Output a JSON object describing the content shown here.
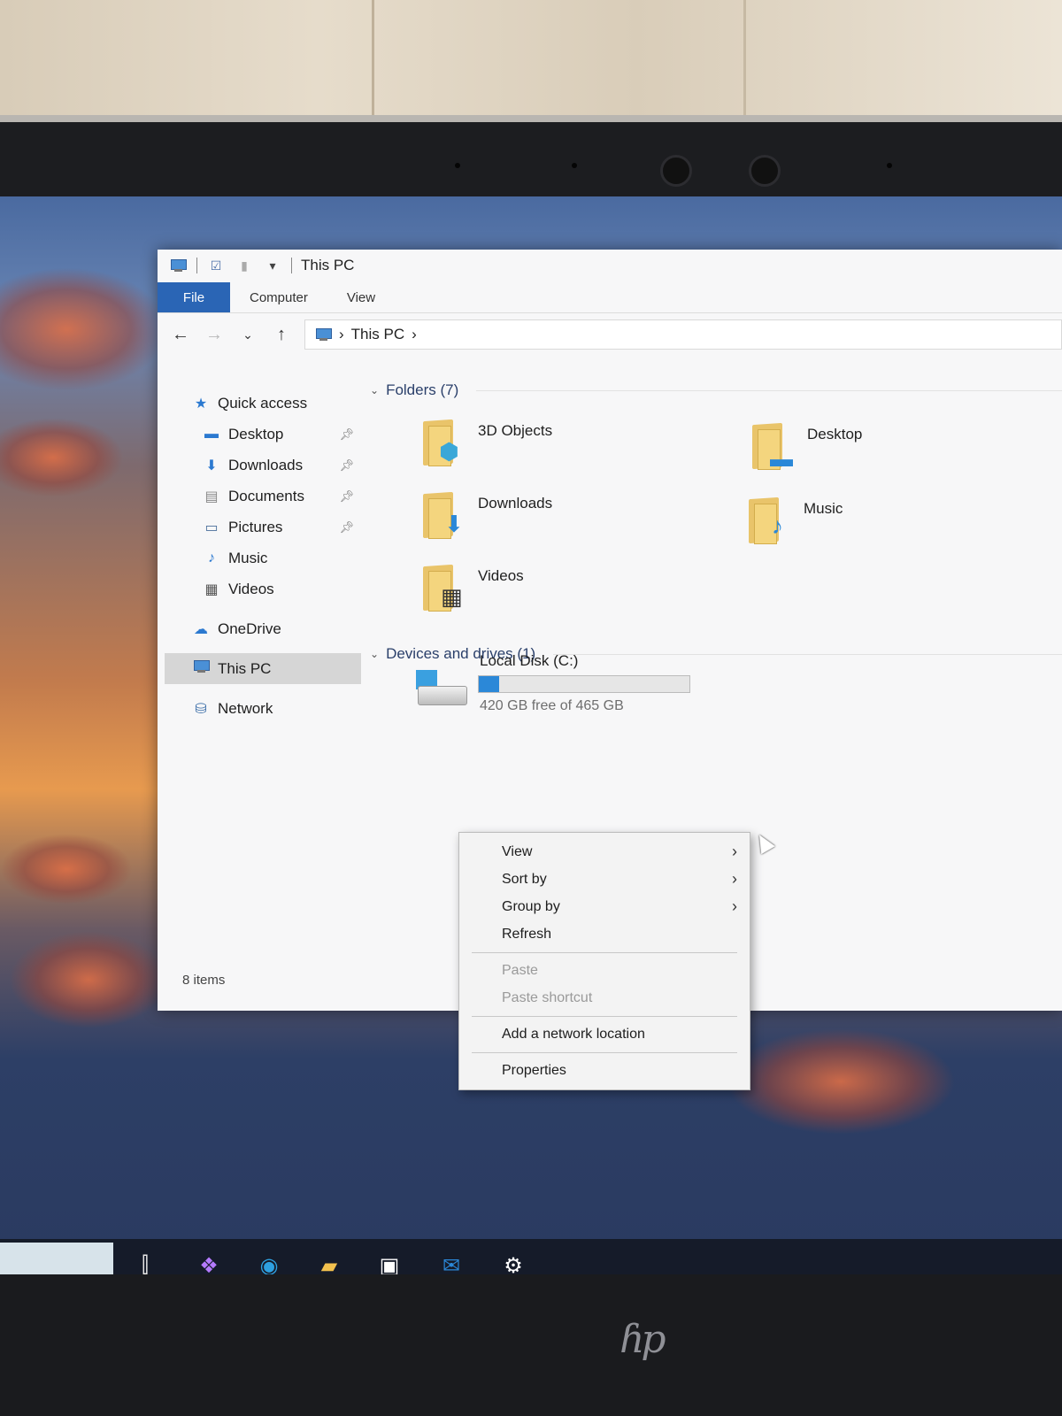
{
  "window": {
    "title": "This PC",
    "ribbon_tabs": [
      "File",
      "Computer",
      "View"
    ],
    "address_path": "This PC"
  },
  "sidebar": {
    "items": [
      {
        "label": "Quick access",
        "icon": "star-icon"
      },
      {
        "label": "Desktop",
        "icon": "desktop-icon",
        "pinned": true
      },
      {
        "label": "Downloads",
        "icon": "download-arrow-icon",
        "pinned": true
      },
      {
        "label": "Documents",
        "icon": "document-icon",
        "pinned": true
      },
      {
        "label": "Pictures",
        "icon": "picture-icon",
        "pinned": true
      },
      {
        "label": "Music",
        "icon": "music-note-icon"
      },
      {
        "label": "Videos",
        "icon": "film-icon"
      },
      {
        "label": "OneDrive",
        "icon": "cloud-icon"
      },
      {
        "label": "This PC",
        "icon": "computer-icon",
        "selected": true
      },
      {
        "label": "Network",
        "icon": "network-icon"
      }
    ]
  },
  "content": {
    "folders_header": "Folders (7)",
    "folders": [
      {
        "name": "3D Objects",
        "icon": "cube-icon"
      },
      {
        "name": "Desktop",
        "icon": "desktop-icon"
      },
      {
        "name": "Downloads",
        "icon": "download-arrow-icon"
      },
      {
        "name": "Music",
        "icon": "music-note-icon"
      },
      {
        "name": "Videos",
        "icon": "film-icon"
      }
    ],
    "devices_header": "Devices and drives (1)",
    "drive": {
      "name": "Local Disk (C:)",
      "free_text": "420 GB free of 465 GB",
      "used_fraction": 0.097
    }
  },
  "status": {
    "items": "8 items"
  },
  "context_menu": {
    "items": [
      {
        "label": "View",
        "submenu": true,
        "enabled": true
      },
      {
        "label": "Sort by",
        "submenu": true,
        "enabled": true
      },
      {
        "label": "Group by",
        "submenu": true,
        "enabled": true
      },
      {
        "label": "Refresh",
        "submenu": false,
        "enabled": true
      },
      {
        "label": "Paste",
        "submenu": false,
        "enabled": false
      },
      {
        "label": "Paste shortcut",
        "submenu": false,
        "enabled": false
      },
      {
        "label": "Add a network location",
        "submenu": false,
        "enabled": true
      },
      {
        "label": "Properties",
        "submenu": false,
        "enabled": true
      }
    ]
  },
  "taskbar": {
    "apps": [
      "task-view-icon",
      "copilot-icon",
      "edge-icon",
      "file-explorer-icon",
      "store-icon",
      "outlook-icon",
      "settings-icon"
    ]
  },
  "colors": {
    "accent": "#2a65b5",
    "drive_bar": "#2b88d8"
  }
}
